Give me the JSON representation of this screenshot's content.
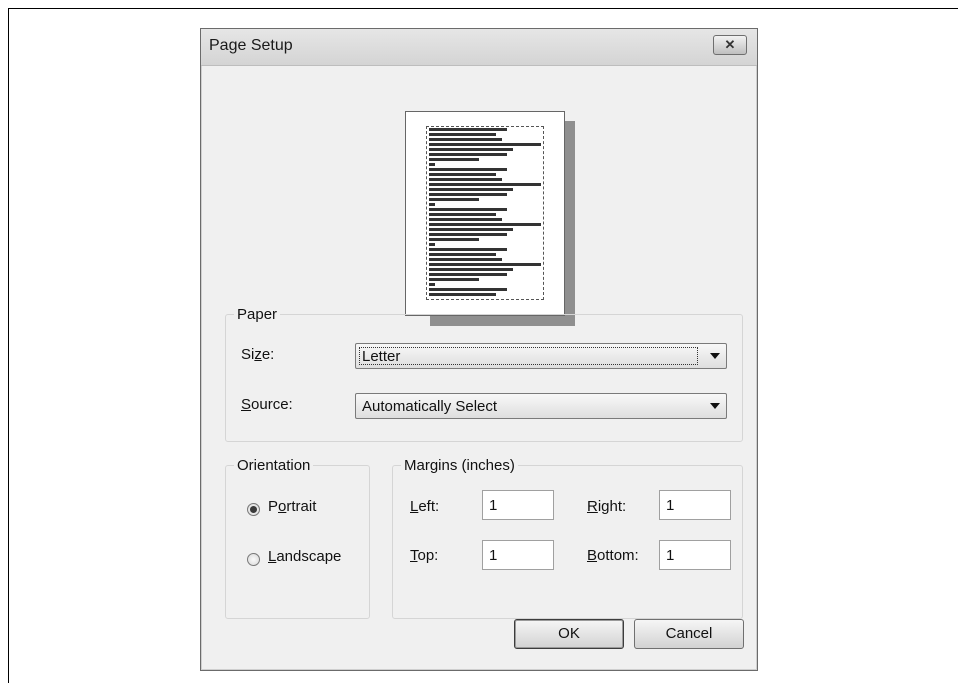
{
  "dialog": {
    "title": "Page Setup",
    "close_symbol": "✕"
  },
  "paper": {
    "legend": "Paper",
    "size_label": {
      "prefix": "Si",
      "mnemonic": "z",
      "suffix": "e:"
    },
    "size_value": "Letter",
    "source_label": {
      "mnemonic": "S",
      "suffix": "ource:"
    },
    "source_value": "Automatically Select"
  },
  "orientation": {
    "legend": "Orientation",
    "portrait": {
      "prefix": "P",
      "mnemonic": "o",
      "suffix": "rtrait",
      "selected": true
    },
    "landscape": {
      "prefix": "",
      "mnemonic": "L",
      "suffix": "andscape",
      "selected": false
    }
  },
  "margins": {
    "legend": "Margins (inches)",
    "left_label": {
      "mnemonic": "L",
      "suffix": "eft:"
    },
    "left_value": "1",
    "right_label": {
      "mnemonic": "R",
      "suffix": "ight:"
    },
    "right_value": "1",
    "top_label": {
      "mnemonic": "T",
      "suffix": "op:"
    },
    "top_value": "1",
    "bottom_label": {
      "mnemonic": "B",
      "suffix": "ottom:"
    },
    "bottom_value": "1"
  },
  "buttons": {
    "ok": "OK",
    "cancel": "Cancel"
  },
  "colors": {
    "dialog_bg": "#f0f0f0",
    "title_bg": "#d4d4d4"
  }
}
